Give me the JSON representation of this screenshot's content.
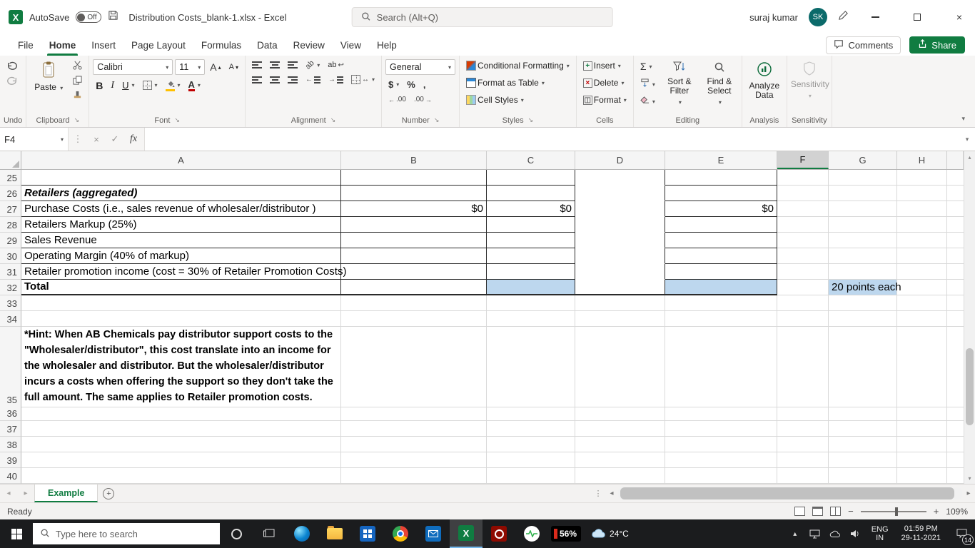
{
  "titlebar": {
    "autosave_label": "AutoSave",
    "autosave_state": "Off",
    "doc_title": "Distribution Costs_blank-1.xlsx - Excel",
    "search_placeholder": "Search (Alt+Q)",
    "user_name": "suraj kumar",
    "user_initials": "SK"
  },
  "ribbon": {
    "tabs": [
      "File",
      "Home",
      "Insert",
      "Page Layout",
      "Formulas",
      "Data",
      "Review",
      "View",
      "Help"
    ],
    "active_tab": "Home",
    "comments": "Comments",
    "share": "Share",
    "paste": "Paste",
    "font_name": "Calibri",
    "font_size": "11",
    "number_format": "General",
    "styles_items": [
      "Conditional Formatting",
      "Format as Table",
      "Cell Styles"
    ],
    "cells_items": [
      "Insert",
      "Delete",
      "Format"
    ],
    "sort_filter": "Sort & Filter",
    "find_select": "Find & Select",
    "analyze_data": "Analyze Data",
    "sensitivity": "Sensitivity",
    "group_labels": [
      "Undo",
      "Clipboard",
      "Font",
      "Alignment",
      "Number",
      "Styles",
      "Cells",
      "Editing",
      "Analysis",
      "Sensitivity"
    ]
  },
  "formula_bar": {
    "name_box": "F4",
    "fx_label": "fx",
    "formula_value": ""
  },
  "grid": {
    "columns": [
      "A",
      "B",
      "C",
      "D",
      "E",
      "F",
      "G",
      "H"
    ],
    "selected_column": "F",
    "rows": [
      {
        "n": "25"
      },
      {
        "n": "26",
        "cells": [
          {
            "col": "A",
            "text": "Retailers (aggregated)",
            "style": "bold italic"
          }
        ]
      },
      {
        "n": "27",
        "cells": [
          {
            "col": "A",
            "text": "Purchase Costs (i.e., sales revenue of wholesaler/distributor )"
          },
          {
            "col": "B",
            "text": "$0",
            "style": "num"
          },
          {
            "col": "C",
            "text": "$0",
            "style": "num"
          },
          {
            "col": "E",
            "text": "$0",
            "style": "num"
          }
        ]
      },
      {
        "n": "28",
        "cells": [
          {
            "col": "A",
            "text": "Retailers Markup (25%)"
          }
        ]
      },
      {
        "n": "29",
        "cells": [
          {
            "col": "A",
            "text": "Sales Revenue"
          }
        ]
      },
      {
        "n": "30",
        "cells": [
          {
            "col": "A",
            "text": "Operating Margin (40% of markup)"
          }
        ]
      },
      {
        "n": "31",
        "cells": [
          {
            "col": "A",
            "text": "Retailer promotion income (cost = 30% of Retailer Promotion Costs)"
          }
        ]
      },
      {
        "n": "32",
        "fills": [
          "C",
          "E",
          "G"
        ],
        "cells": [
          {
            "col": "A",
            "text": "Total",
            "style": "bold"
          },
          {
            "col": "G",
            "text": "20 points each"
          }
        ]
      },
      {
        "n": "33"
      },
      {
        "n": "34"
      },
      {
        "n": "35",
        "height": 110,
        "cells": [
          {
            "col": "A",
            "text": "*Hint: When AB Chemicals pay distributor support costs to the \"Wholesaler/distributor\", this cost translate into an income for the wholesaler and distributor. But the wholesaler/distributor incurs a costs when offering the support so they  don't take the full amount. The same applies to Retailer promotion costs.",
            "style": "bold wrap"
          }
        ]
      },
      {
        "n": "36"
      },
      {
        "n": "37"
      },
      {
        "n": "38"
      },
      {
        "n": "39"
      },
      {
        "n": "40"
      }
    ]
  },
  "sheet_tabs": {
    "active": "Example"
  },
  "status_bar": {
    "mode": "Ready",
    "zoom": "109%"
  },
  "taskbar": {
    "search_placeholder": "Type here to search",
    "battery": "56%",
    "weather": "24°C",
    "lang_line1": "ENG",
    "lang_line2": "IN",
    "time": "01:59 PM",
    "date": "29-11-2021",
    "notification_count": "14"
  }
}
